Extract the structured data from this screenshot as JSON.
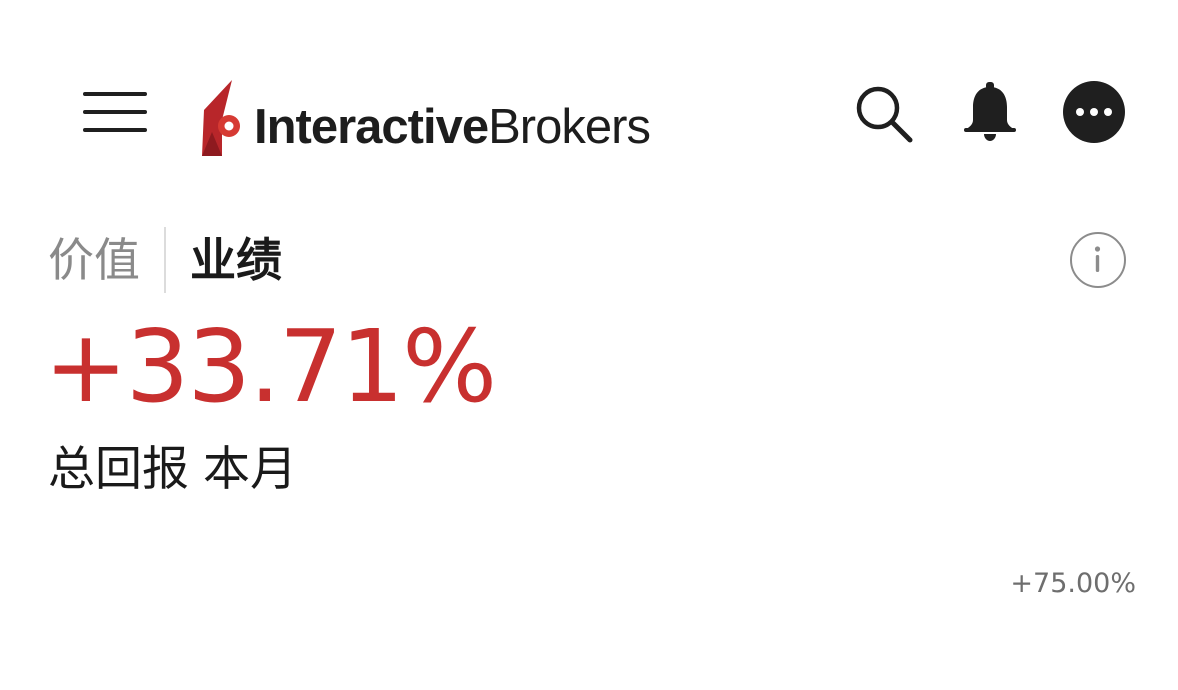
{
  "header": {
    "menu_icon": "hamburger-menu-icon",
    "logo": {
      "text_bold": "Interactive",
      "text_regular": "Brokers",
      "brand_color": "#c8302f"
    },
    "search_icon": "search-icon",
    "bell_icon": "bell-icon",
    "more_icon": "more-horizontal-icon"
  },
  "tabs": [
    {
      "label": "价值",
      "active": false
    },
    {
      "label": "业绩",
      "active": true
    }
  ],
  "info_icon": "info-icon",
  "performance": {
    "total_return": "+33.71%",
    "return_label": "总回报",
    "period_label": "本月",
    "accent_color": "#c8302f"
  },
  "chart": {
    "axis_max_label": "+75.00%"
  }
}
